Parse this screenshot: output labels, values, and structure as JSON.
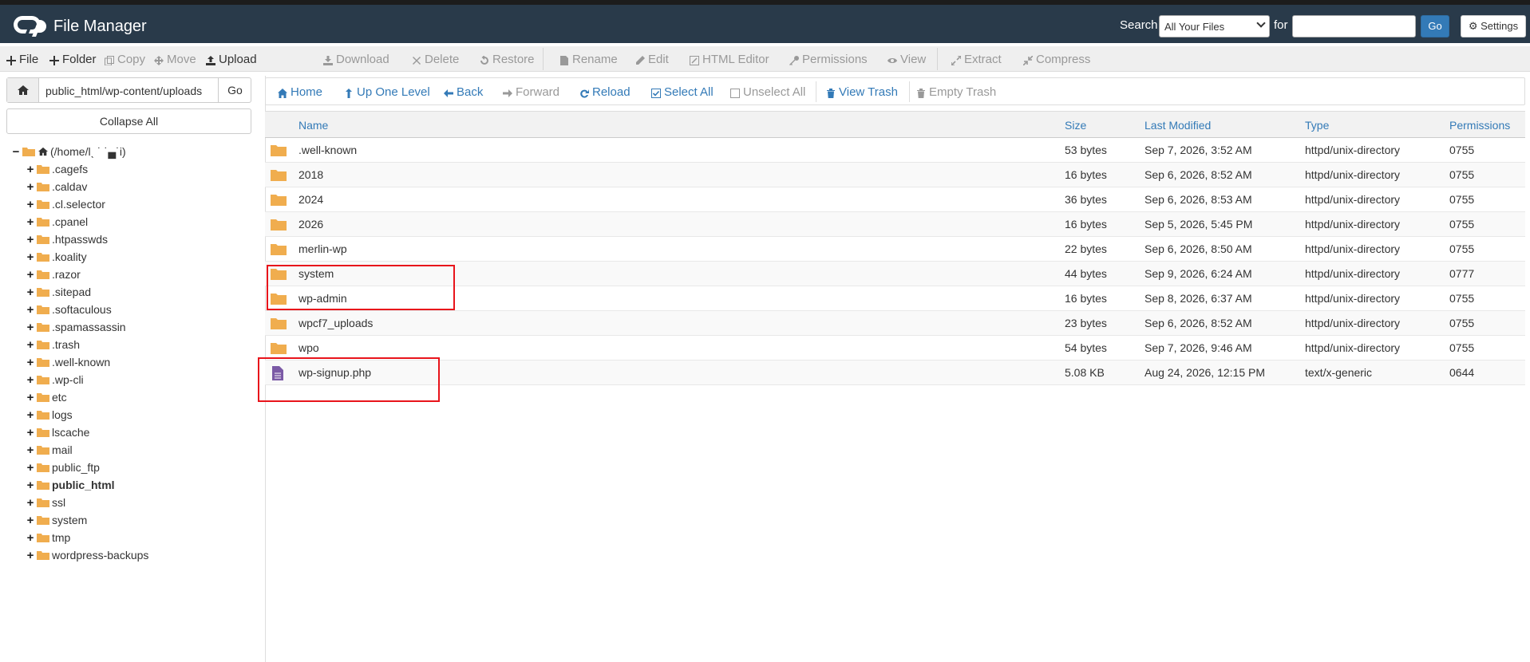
{
  "header": {
    "app_title": "File Manager",
    "search_label": "Search",
    "search_scope": "All Your Files",
    "for_label": "for",
    "search_query": "",
    "go_label": "Go",
    "settings_label": "Settings"
  },
  "toolbar": {
    "items": [
      {
        "label": "File",
        "icon": "plus-icon",
        "enabled": true
      },
      {
        "label": "Folder",
        "icon": "plus-icon",
        "enabled": true
      },
      {
        "label": "Copy",
        "icon": "copy-icon",
        "enabled": false
      },
      {
        "label": "Move",
        "icon": "move-icon",
        "enabled": false
      },
      {
        "label": "Upload",
        "icon": "upload-icon",
        "enabled": true
      },
      {
        "label": "Download",
        "icon": "download-icon",
        "enabled": false
      },
      {
        "label": "Delete",
        "icon": "delete-icon",
        "enabled": false
      },
      {
        "label": "Restore",
        "icon": "restore-icon",
        "enabled": false
      },
      {
        "label": "Rename",
        "icon": "rename-icon",
        "enabled": false
      },
      {
        "label": "Edit",
        "icon": "edit-icon",
        "enabled": false
      },
      {
        "label": "HTML Editor",
        "icon": "html-editor-icon",
        "enabled": false
      },
      {
        "label": "Permissions",
        "icon": "key-icon",
        "enabled": false
      },
      {
        "label": "View",
        "icon": "eye-icon",
        "enabled": false
      },
      {
        "label": "Extract",
        "icon": "extract-icon",
        "enabled": false
      },
      {
        "label": "Compress",
        "icon": "compress-icon",
        "enabled": false
      }
    ]
  },
  "sidebar": {
    "path_value": "public_html/wp-content/uploads",
    "go_label": "Go",
    "collapse_label": "Collapse All",
    "root_label": "(/home/lˎ ˙ ˙▄˙i)",
    "items": [
      {
        "label": ".cagefs",
        "bold": false
      },
      {
        "label": ".caldav",
        "bold": false
      },
      {
        "label": ".cl.selector",
        "bold": false
      },
      {
        "label": ".cpanel",
        "bold": false
      },
      {
        "label": ".htpasswds",
        "bold": false
      },
      {
        "label": ".koality",
        "bold": false
      },
      {
        "label": ".razor",
        "bold": false
      },
      {
        "label": ".sitepad",
        "bold": false
      },
      {
        "label": ".softaculous",
        "bold": false
      },
      {
        "label": ".spamassassin",
        "bold": false
      },
      {
        "label": ".trash",
        "bold": false
      },
      {
        "label": ".well-known",
        "bold": false
      },
      {
        "label": ".wp-cli",
        "bold": false
      },
      {
        "label": "etc",
        "bold": false
      },
      {
        "label": "logs",
        "bold": false
      },
      {
        "label": "lscache",
        "bold": false
      },
      {
        "label": "mail",
        "bold": false
      },
      {
        "label": "public_ftp",
        "bold": false
      },
      {
        "label": "public_html",
        "bold": true
      },
      {
        "label": "ssl",
        "bold": false
      },
      {
        "label": "system",
        "bold": false
      },
      {
        "label": "tmp",
        "bold": false
      },
      {
        "label": "wordpress-backups",
        "bold": false
      }
    ]
  },
  "nav": {
    "items": [
      {
        "label": "Home",
        "icon": "home-icon",
        "enabled": true
      },
      {
        "label": "Up One Level",
        "icon": "up-arrow-icon",
        "enabled": true
      },
      {
        "label": "Back",
        "icon": "back-arrow-icon",
        "enabled": true
      },
      {
        "label": "Forward",
        "icon": "forward-arrow-icon",
        "enabled": false
      },
      {
        "label": "Reload",
        "icon": "reload-icon",
        "enabled": true
      },
      {
        "label": "Select All",
        "icon": "checkbox-checked-icon",
        "enabled": true
      },
      {
        "label": "Unselect All",
        "icon": "checkbox-empty-icon",
        "enabled": false
      },
      {
        "label": "View Trash",
        "icon": "trash-icon",
        "enabled": true
      },
      {
        "label": "Empty Trash",
        "icon": "trash-icon",
        "enabled": false
      }
    ]
  },
  "table": {
    "columns": {
      "name": "Name",
      "size": "Size",
      "modified": "Last Modified",
      "type": "Type",
      "perms": "Permissions"
    },
    "rows": [
      {
        "name": ".well-known",
        "size": "53 bytes",
        "modified": "Sep 7, 2026, 3:52 AM",
        "type": "httpd/unix-directory",
        "perms": "0755",
        "kind": "folder"
      },
      {
        "name": "2018",
        "size": "16 bytes",
        "modified": "Sep 6, 2026, 8:52 AM",
        "type": "httpd/unix-directory",
        "perms": "0755",
        "kind": "folder"
      },
      {
        "name": "2024",
        "size": "36 bytes",
        "modified": "Sep 6, 2026, 8:53 AM",
        "type": "httpd/unix-directory",
        "perms": "0755",
        "kind": "folder"
      },
      {
        "name": "2026",
        "size": "16 bytes",
        "modified": "Sep 5, 2026, 5:45 PM",
        "type": "httpd/unix-directory",
        "perms": "0755",
        "kind": "folder"
      },
      {
        "name": "merlin-wp",
        "size": "22 bytes",
        "modified": "Sep 6, 2026, 8:50 AM",
        "type": "httpd/unix-directory",
        "perms": "0755",
        "kind": "folder"
      },
      {
        "name": "system",
        "size": "44 bytes",
        "modified": "Sep 9, 2026, 6:24 AM",
        "type": "httpd/unix-directory",
        "perms": "0777",
        "kind": "folder"
      },
      {
        "name": "wp-admin",
        "size": "16 bytes",
        "modified": "Sep 8, 2026, 6:37 AM",
        "type": "httpd/unix-directory",
        "perms": "0755",
        "kind": "folder"
      },
      {
        "name": "wpcf7_uploads",
        "size": "23 bytes",
        "modified": "Sep 6, 2026, 8:52 AM",
        "type": "httpd/unix-directory",
        "perms": "0755",
        "kind": "folder"
      },
      {
        "name": "wpo",
        "size": "54 bytes",
        "modified": "Sep 7, 2026, 9:46 AM",
        "type": "httpd/unix-directory",
        "perms": "0755",
        "kind": "folder"
      },
      {
        "name": "wp-signup.php",
        "size": "5.08 KB",
        "modified": "Aug 24, 2026, 12:15 PM",
        "type": "text/x-generic",
        "perms": "0644",
        "kind": "file"
      }
    ]
  },
  "colors": {
    "header_bg": "#293a4a",
    "link_blue": "#337ab7",
    "folder": "#f0ad4e",
    "file_icon": "#7b5aa6",
    "highlight": "#e8141b"
  }
}
